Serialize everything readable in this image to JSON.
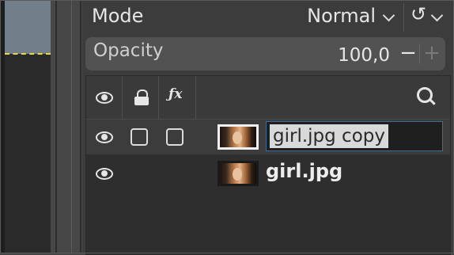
{
  "mode": {
    "label": "Mode",
    "value": "Normal",
    "reset_icon": "undo-icon"
  },
  "opacity": {
    "label": "Opacity",
    "value": "100,0",
    "minus": "−",
    "plus": "+"
  },
  "layers_header": {
    "visibility_icon": "eye-icon",
    "lock_icon": "lock-icon",
    "effects_label": "ƒx",
    "search_icon": "search-icon"
  },
  "layers": [
    {
      "name": "girl.jpg copy",
      "visible": true,
      "editing": true
    },
    {
      "name": "girl.jpg",
      "visible": true,
      "editing": false
    }
  ],
  "colors": {
    "selection_outline": "#e8dc3c",
    "edit_border": "#3d6a9a"
  }
}
